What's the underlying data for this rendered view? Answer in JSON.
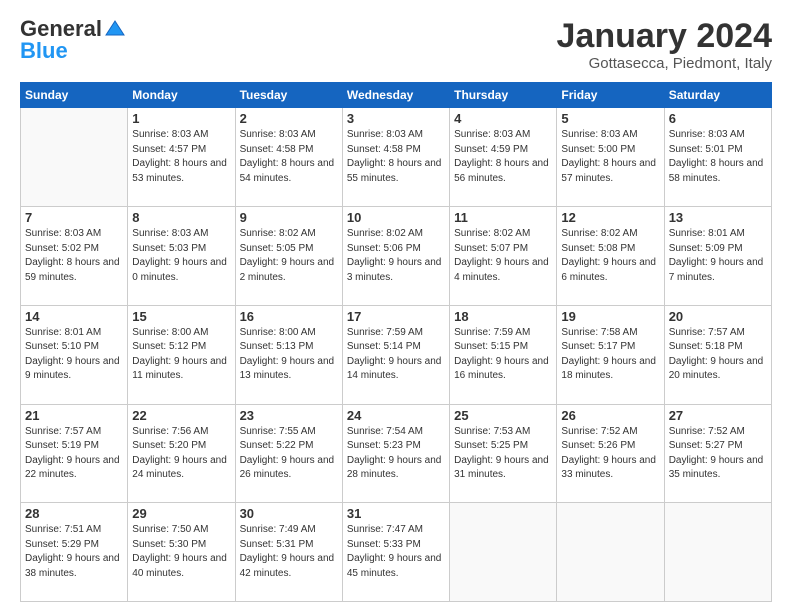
{
  "header": {
    "logo_general": "General",
    "logo_blue": "Blue",
    "month_title": "January 2024",
    "location": "Gottasecca, Piedmont, Italy"
  },
  "weekdays": [
    "Sunday",
    "Monday",
    "Tuesday",
    "Wednesday",
    "Thursday",
    "Friday",
    "Saturday"
  ],
  "weeks": [
    [
      {
        "day": "",
        "sunrise": "",
        "sunset": "",
        "daylight": ""
      },
      {
        "day": "1",
        "sunrise": "Sunrise: 8:03 AM",
        "sunset": "Sunset: 4:57 PM",
        "daylight": "Daylight: 8 hours and 53 minutes."
      },
      {
        "day": "2",
        "sunrise": "Sunrise: 8:03 AM",
        "sunset": "Sunset: 4:58 PM",
        "daylight": "Daylight: 8 hours and 54 minutes."
      },
      {
        "day": "3",
        "sunrise": "Sunrise: 8:03 AM",
        "sunset": "Sunset: 4:58 PM",
        "daylight": "Daylight: 8 hours and 55 minutes."
      },
      {
        "day": "4",
        "sunrise": "Sunrise: 8:03 AM",
        "sunset": "Sunset: 4:59 PM",
        "daylight": "Daylight: 8 hours and 56 minutes."
      },
      {
        "day": "5",
        "sunrise": "Sunrise: 8:03 AM",
        "sunset": "Sunset: 5:00 PM",
        "daylight": "Daylight: 8 hours and 57 minutes."
      },
      {
        "day": "6",
        "sunrise": "Sunrise: 8:03 AM",
        "sunset": "Sunset: 5:01 PM",
        "daylight": "Daylight: 8 hours and 58 minutes."
      }
    ],
    [
      {
        "day": "7",
        "sunrise": "Sunrise: 8:03 AM",
        "sunset": "Sunset: 5:02 PM",
        "daylight": "Daylight: 8 hours and 59 minutes."
      },
      {
        "day": "8",
        "sunrise": "Sunrise: 8:03 AM",
        "sunset": "Sunset: 5:03 PM",
        "daylight": "Daylight: 9 hours and 0 minutes."
      },
      {
        "day": "9",
        "sunrise": "Sunrise: 8:02 AM",
        "sunset": "Sunset: 5:05 PM",
        "daylight": "Daylight: 9 hours and 2 minutes."
      },
      {
        "day": "10",
        "sunrise": "Sunrise: 8:02 AM",
        "sunset": "Sunset: 5:06 PM",
        "daylight": "Daylight: 9 hours and 3 minutes."
      },
      {
        "day": "11",
        "sunrise": "Sunrise: 8:02 AM",
        "sunset": "Sunset: 5:07 PM",
        "daylight": "Daylight: 9 hours and 4 minutes."
      },
      {
        "day": "12",
        "sunrise": "Sunrise: 8:02 AM",
        "sunset": "Sunset: 5:08 PM",
        "daylight": "Daylight: 9 hours and 6 minutes."
      },
      {
        "day": "13",
        "sunrise": "Sunrise: 8:01 AM",
        "sunset": "Sunset: 5:09 PM",
        "daylight": "Daylight: 9 hours and 7 minutes."
      }
    ],
    [
      {
        "day": "14",
        "sunrise": "Sunrise: 8:01 AM",
        "sunset": "Sunset: 5:10 PM",
        "daylight": "Daylight: 9 hours and 9 minutes."
      },
      {
        "day": "15",
        "sunrise": "Sunrise: 8:00 AM",
        "sunset": "Sunset: 5:12 PM",
        "daylight": "Daylight: 9 hours and 11 minutes."
      },
      {
        "day": "16",
        "sunrise": "Sunrise: 8:00 AM",
        "sunset": "Sunset: 5:13 PM",
        "daylight": "Daylight: 9 hours and 13 minutes."
      },
      {
        "day": "17",
        "sunrise": "Sunrise: 7:59 AM",
        "sunset": "Sunset: 5:14 PM",
        "daylight": "Daylight: 9 hours and 14 minutes."
      },
      {
        "day": "18",
        "sunrise": "Sunrise: 7:59 AM",
        "sunset": "Sunset: 5:15 PM",
        "daylight": "Daylight: 9 hours and 16 minutes."
      },
      {
        "day": "19",
        "sunrise": "Sunrise: 7:58 AM",
        "sunset": "Sunset: 5:17 PM",
        "daylight": "Daylight: 9 hours and 18 minutes."
      },
      {
        "day": "20",
        "sunrise": "Sunrise: 7:57 AM",
        "sunset": "Sunset: 5:18 PM",
        "daylight": "Daylight: 9 hours and 20 minutes."
      }
    ],
    [
      {
        "day": "21",
        "sunrise": "Sunrise: 7:57 AM",
        "sunset": "Sunset: 5:19 PM",
        "daylight": "Daylight: 9 hours and 22 minutes."
      },
      {
        "day": "22",
        "sunrise": "Sunrise: 7:56 AM",
        "sunset": "Sunset: 5:20 PM",
        "daylight": "Daylight: 9 hours and 24 minutes."
      },
      {
        "day": "23",
        "sunrise": "Sunrise: 7:55 AM",
        "sunset": "Sunset: 5:22 PM",
        "daylight": "Daylight: 9 hours and 26 minutes."
      },
      {
        "day": "24",
        "sunrise": "Sunrise: 7:54 AM",
        "sunset": "Sunset: 5:23 PM",
        "daylight": "Daylight: 9 hours and 28 minutes."
      },
      {
        "day": "25",
        "sunrise": "Sunrise: 7:53 AM",
        "sunset": "Sunset: 5:25 PM",
        "daylight": "Daylight: 9 hours and 31 minutes."
      },
      {
        "day": "26",
        "sunrise": "Sunrise: 7:52 AM",
        "sunset": "Sunset: 5:26 PM",
        "daylight": "Daylight: 9 hours and 33 minutes."
      },
      {
        "day": "27",
        "sunrise": "Sunrise: 7:52 AM",
        "sunset": "Sunset: 5:27 PM",
        "daylight": "Daylight: 9 hours and 35 minutes."
      }
    ],
    [
      {
        "day": "28",
        "sunrise": "Sunrise: 7:51 AM",
        "sunset": "Sunset: 5:29 PM",
        "daylight": "Daylight: 9 hours and 38 minutes."
      },
      {
        "day": "29",
        "sunrise": "Sunrise: 7:50 AM",
        "sunset": "Sunset: 5:30 PM",
        "daylight": "Daylight: 9 hours and 40 minutes."
      },
      {
        "day": "30",
        "sunrise": "Sunrise: 7:49 AM",
        "sunset": "Sunset: 5:31 PM",
        "daylight": "Daylight: 9 hours and 42 minutes."
      },
      {
        "day": "31",
        "sunrise": "Sunrise: 7:47 AM",
        "sunset": "Sunset: 5:33 PM",
        "daylight": "Daylight: 9 hours and 45 minutes."
      },
      {
        "day": "",
        "sunrise": "",
        "sunset": "",
        "daylight": ""
      },
      {
        "day": "",
        "sunrise": "",
        "sunset": "",
        "daylight": ""
      },
      {
        "day": "",
        "sunrise": "",
        "sunset": "",
        "daylight": ""
      }
    ]
  ]
}
